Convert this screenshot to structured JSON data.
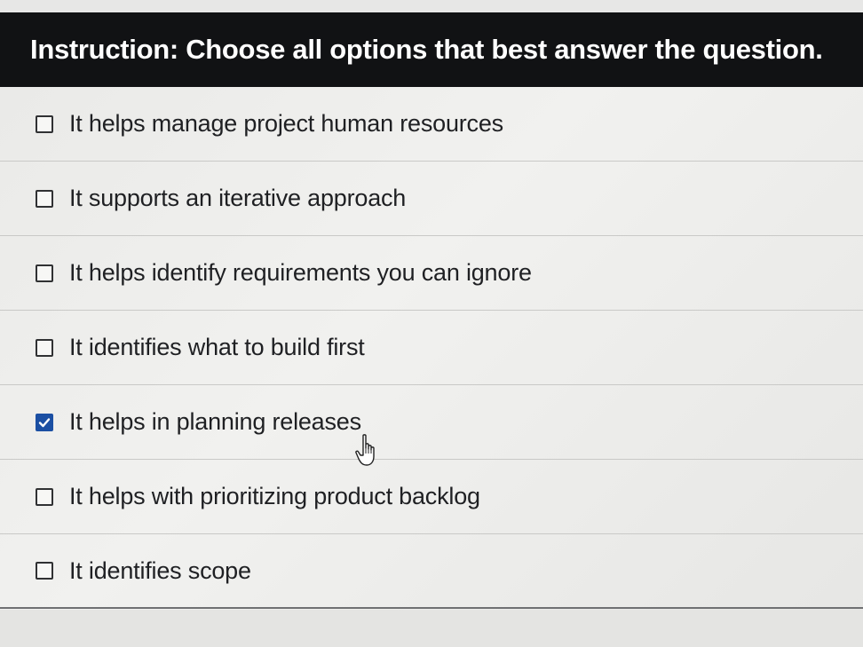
{
  "instruction": {
    "text": "Instruction: Choose all options that best answer the question."
  },
  "options": [
    {
      "label": "It helps manage project human resources",
      "checked": false
    },
    {
      "label": "It supports an iterative approach",
      "checked": false
    },
    {
      "label": "It helps identify requirements you can ignore",
      "checked": false
    },
    {
      "label": "It identifies what to build first",
      "checked": false
    },
    {
      "label": "It helps in planning releases",
      "checked": true
    },
    {
      "label": "It helps with prioritizing product backlog",
      "checked": false
    },
    {
      "label": "It identifies scope",
      "checked": false
    }
  ],
  "colors": {
    "instruction_bar": "#111214",
    "checkbox_checked": "#1b4fa3",
    "text": "#1f2023"
  },
  "icons": {
    "checkmark": "check-icon",
    "cursor": "hand-pointer-icon"
  }
}
